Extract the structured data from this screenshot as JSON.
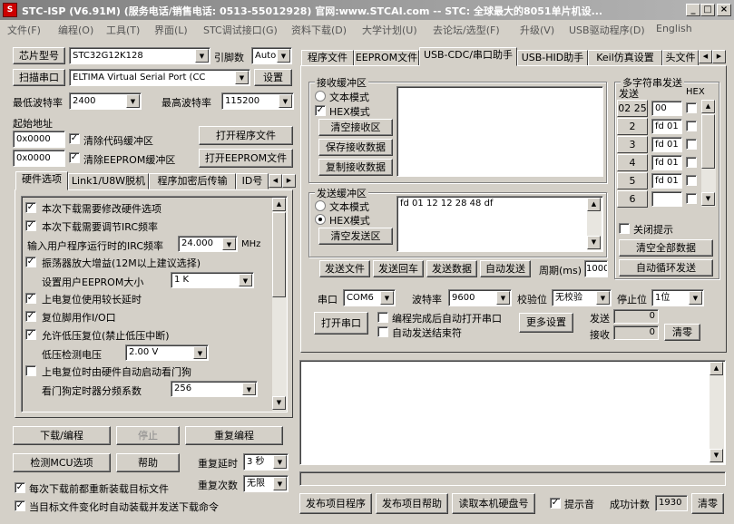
{
  "title": "STC-ISP (V6.91M) (服务电话/销售电话: 0513-55012928) 官网:www.STCAI.com -- STC: 全球最大的8051单片机设...",
  "title_icon": "stc-logo-icon",
  "menu": [
    "文件(F)",
    "编程(O)",
    "工具(T)",
    "界面(L)",
    "STC调试接口(G)",
    "资料下载(D)",
    "大学计划(U)",
    "去论坛/选型(F)",
    "升级(V)",
    "USB驱动程序(D)",
    "English"
  ],
  "left": {
    "chip_btn": "芯片型号",
    "chip_value": "STC32G12K128",
    "pin_label": "引脚数",
    "pin_value": "Auto",
    "scan_btn": "扫描串口",
    "port_value": "ELTIMA Virtual Serial Port (CC",
    "settings_btn": "设置",
    "min_baud_label": "最低波特率",
    "min_baud": "2400",
    "max_baud_label": "最高波特率",
    "max_baud": "115200",
    "start_addr_label": "起始地址",
    "addr1": "0x0000",
    "clear_code": "清除代码缓冲区",
    "open_prog": "打开程序文件",
    "addr2": "0x0000",
    "clear_eeprom": "清除EEPROM缓冲区",
    "open_eeprom": "打开EEPROM文件",
    "tabs": [
      "硬件选项",
      "Link1/U8W脱机",
      "程序加密后传输",
      "ID号"
    ],
    "options": {
      "o1": "本次下载需要修改硬件选项",
      "o2": "本次下载需要调节IRC频率",
      "irc_label": "输入用户程序运行时的IRC频率",
      "irc_value": "24.000",
      "irc_unit": "MHz",
      "o3": "振荡器放大增益(12M以上建议选择)",
      "eeprom_label": "设置用户EEPROM大小",
      "eeprom_value": "1    K",
      "o4": "上电复位使用较长延时",
      "o5": "复位脚用作I/O口",
      "o6": "允许低压复位(禁止低压中断)",
      "lv_label": "低压检测电压",
      "lv_value": "2.00 V",
      "o7": "上电复位时由硬件自动启动看门狗",
      "wd_label": "看门狗定时器分频系数",
      "wd_value": "256"
    },
    "download_btn": "下载/编程",
    "stop_btn": "停止",
    "reprogram_btn": "重复编程",
    "detect_btn": "检测MCU选项",
    "help_btn": "帮助",
    "repeat_delay_label": "重复延时",
    "repeat_delay": "3 秒",
    "repeat_count_label": "重复次数",
    "repeat_count": "无限",
    "reload_label": "每次下载前都重新装载目标文件",
    "auto_send_label": "当目标文件变化时自动装载并发送下载命令"
  },
  "right": {
    "tabs": [
      "程序文件",
      "EEPROM文件",
      "USB-CDC/串口助手",
      "USB-HID助手",
      "Keil仿真设置",
      "头文件"
    ],
    "recv_group": "接收缓冲区",
    "text_mode": "文本模式",
    "hex_mode": "HEX模式",
    "clear_recv": "清空接收区",
    "save_recv": "保存接收数据",
    "copy_recv": "复制接收数据",
    "send_group": "发送缓冲区",
    "send_text_mode": "文本模式",
    "send_hex_mode": "HEX模式",
    "clear_send": "清空发送区",
    "send_content": "fd 01 12 12 28 48 df",
    "send_file": "发送文件",
    "send_enter": "发送回车",
    "send_data": "发送数据",
    "auto_send": "自动发送",
    "period_label": "周期(ms)",
    "period_value": "1000",
    "multi_group": "多字符串发送",
    "col_send": "发送",
    "col_hex": "HEX",
    "multi_rows": [
      {
        "num": "02 25",
        "value": "00"
      },
      {
        "num": "2",
        "value": "fd 01"
      },
      {
        "num": "3",
        "value": "fd 01"
      },
      {
        "num": "4",
        "value": "fd 01"
      },
      {
        "num": "5",
        "value": "fd 01"
      },
      {
        "num": "6",
        "value": ""
      }
    ],
    "close_tips": "关闭提示",
    "clear_all": "清空全部数据",
    "auto_loop": "自动循环发送",
    "port_label": "串口",
    "port_value": "COM6",
    "baud_label": "波特率",
    "baud_value": "9600",
    "parity_label": "校验位",
    "parity_value": "无校验",
    "stop_label": "停止位",
    "stop_value": "1位",
    "open_port": "打开串口",
    "auto_open": "编程完成后自动打开串口",
    "auto_end": "自动发送结束符",
    "more_settings": "更多设置",
    "send_count_label": "发送",
    "send_count": "0",
    "recv_count_label": "接收",
    "recv_count": "0",
    "zero_btn": "清零"
  },
  "bottom": {
    "publish_prog": "发布项目程序",
    "publish_help": "发布项目帮助",
    "read_serial": "读取本机硬盘号",
    "beep_label": "提示音",
    "success_label": "成功计数",
    "success_count": "1930",
    "clear_btn": "清零"
  }
}
